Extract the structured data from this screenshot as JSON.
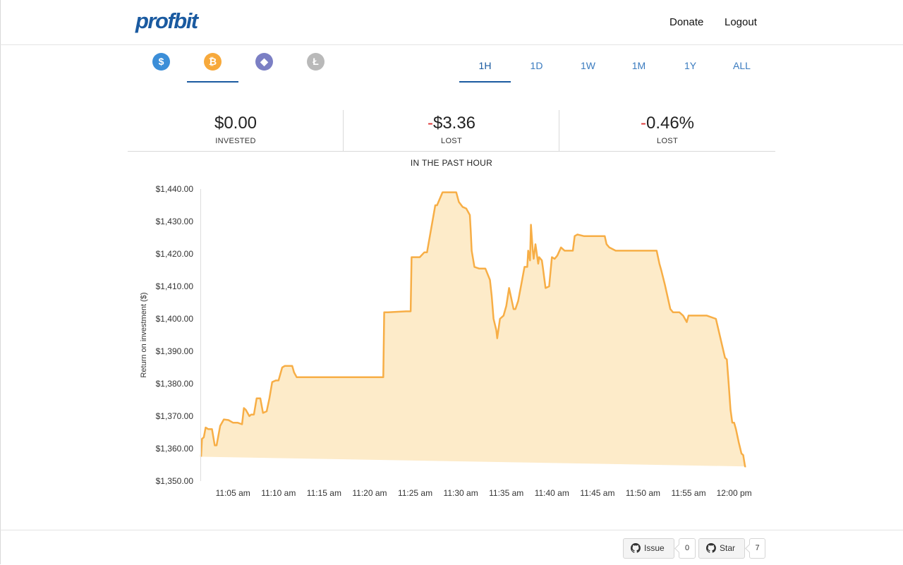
{
  "header": {
    "logo": "profbit",
    "nav": {
      "donate": "Donate",
      "logout": "Logout"
    }
  },
  "coins": [
    {
      "name": "USD",
      "glyph": "$",
      "color": "#3b8ed8",
      "active": false,
      "icon": "dollar-icon"
    },
    {
      "name": "Bitcoin",
      "glyph": "₿",
      "color": "#f7a93b",
      "active": true,
      "icon": "bitcoin-icon"
    },
    {
      "name": "Ethereum",
      "glyph": "◆",
      "color": "#7b7fc4",
      "active": false,
      "icon": "ethereum-icon"
    },
    {
      "name": "Litecoin",
      "glyph": "Ł",
      "color": "#b9b9b9",
      "active": false,
      "icon": "litecoin-icon"
    }
  ],
  "ranges": [
    {
      "label": "1H",
      "active": true
    },
    {
      "label": "1D",
      "active": false
    },
    {
      "label": "1W",
      "active": false
    },
    {
      "label": "1M",
      "active": false
    },
    {
      "label": "1Y",
      "active": false
    },
    {
      "label": "ALL",
      "active": false
    }
  ],
  "stats": {
    "invested": {
      "value": "$0.00",
      "label": "INVESTED"
    },
    "lost_amount": {
      "sign": "-",
      "value": "$3.36",
      "label": "LOST"
    },
    "lost_percent": {
      "sign": "-",
      "value": "0.46%",
      "label": "LOST"
    }
  },
  "chart_title": "IN THE PAST HOUR",
  "chart_data": {
    "type": "area",
    "ylabel": "Return on investment ($)",
    "ylim": [
      1350,
      1440
    ],
    "xlim": [
      1.5,
      61.5
    ],
    "y_ticks": [
      1350,
      1360,
      1370,
      1380,
      1390,
      1400,
      1410,
      1420,
      1430,
      1440
    ],
    "y_tick_labels": [
      "$1,350.00",
      "$1,360.00",
      "$1,370.00",
      "$1,380.00",
      "$1,390.00",
      "$1,400.00",
      "$1,410.00",
      "$1,420.00",
      "$1,430.00",
      "$1,440.00"
    ],
    "x_ticks": [
      5,
      10,
      15,
      20,
      25,
      30,
      35,
      40,
      45,
      50,
      55,
      60
    ],
    "x_tick_labels": [
      "11:05 am",
      "11:10 am",
      "11:15 am",
      "11:20 am",
      "11:25 am",
      "11:30 am",
      "11:35 am",
      "11:40 am",
      "11:45 am",
      "11:50 am",
      "11:55 am",
      "12:00 pm"
    ],
    "line_color": "#f7ae46",
    "fill_color": "#fdebc9",
    "grid": false,
    "x": [
      1.5,
      1.6,
      1.8,
      2.0,
      2.3,
      2.7,
      3.0,
      3.2,
      3.6,
      4.0,
      4.5,
      5.0,
      5.5,
      6.0,
      6.2,
      6.4,
      6.8,
      7.0,
      7.3,
      7.6,
      8.0,
      8.3,
      8.7,
      9.0,
      9.3,
      9.7,
      10.0,
      10.4,
      10.7,
      11.0,
      11.5,
      11.7,
      12.0,
      14.0,
      16.0,
      18.0,
      20.0,
      21.5,
      21.6,
      22.0,
      24.0,
      24.5,
      24.6,
      25.5,
      26.0,
      26.3,
      27.2,
      27.4,
      28.0,
      29.0,
      29.5,
      29.8,
      30.2,
      30.6,
      31.0,
      31.1,
      31.2,
      31.5,
      32.0,
      32.7,
      33.2,
      33.4,
      33.6,
      33.9,
      34.0,
      34.3,
      34.7,
      35.0,
      35.3,
      35.8,
      36.0,
      36.3,
      36.6,
      37.0,
      37.3,
      37.4,
      37.6,
      37.7,
      37.8,
      37.9,
      38.0,
      38.2,
      38.5,
      38.6,
      38.9,
      39.0,
      39.3,
      39.7,
      40.0,
      40.3,
      40.6,
      41.0,
      41.4,
      41.8,
      42.3,
      42.5,
      42.8,
      43.5,
      44.5,
      45.0,
      45.5,
      45.8,
      46.0,
      46.3,
      47.0,
      48.0,
      50.0,
      51.5,
      51.8,
      52.0,
      52.4,
      53.0,
      53.3,
      54.0,
      54.4,
      54.8,
      55.0,
      55.4,
      56.0,
      57.0,
      58.0,
      59.0,
      59.2,
      59.4,
      59.6,
      59.8,
      60.0,
      60.2,
      60.5,
      60.8,
      61.0,
      61.2,
      61.3,
      61.4,
      61.5
    ],
    "y": [
      1357.5,
      1363.0,
      1363.5,
      1366.5,
      1366.0,
      1366.0,
      1361.0,
      1361.0,
      1367.0,
      1369.0,
      1368.8,
      1368.0,
      1368.0,
      1367.5,
      1372.5,
      1372.0,
      1370.0,
      1370.5,
      1370.5,
      1375.5,
      1375.5,
      1371.0,
      1371.5,
      1375.5,
      1380.5,
      1381.0,
      1381.0,
      1385.0,
      1385.5,
      1385.5,
      1385.5,
      1383.5,
      1382.0,
      1382.0,
      1382.0,
      1382.0,
      1382.0,
      1382.0,
      1402.0,
      1402.0,
      1402.3,
      1402.3,
      1419.0,
      1419.0,
      1420.5,
      1420.5,
      1435.0,
      1435.0,
      1439.0,
      1439.0,
      1439.0,
      1436.0,
      1434.5,
      1434.0,
      1432.0,
      1427.0,
      1421.0,
      1416.0,
      1415.5,
      1415.5,
      1412.0,
      1407.0,
      1400.0,
      1396.5,
      1394.0,
      1400.0,
      1401.0,
      1404.0,
      1409.5,
      1403.0,
      1403.0,
      1405.5,
      1410.0,
      1416.0,
      1416.0,
      1421.0,
      1418.0,
      1429.0,
      1425.0,
      1421.0,
      1418.5,
      1423.0,
      1417.0,
      1419.0,
      1418.0,
      1416.0,
      1409.5,
      1410.0,
      1419.0,
      1418.5,
      1419.5,
      1422.0,
      1421.0,
      1421.0,
      1421.0,
      1425.5,
      1426.0,
      1425.5,
      1425.5,
      1425.5,
      1425.5,
      1425.5,
      1423.0,
      1422.0,
      1421.0,
      1421.0,
      1421.0,
      1421.0,
      1417.0,
      1415.0,
      1410.5,
      1403.0,
      1402.0,
      1402.0,
      1401.0,
      1399.0,
      1401.0,
      1401.0,
      1401.0,
      1401.0,
      1400.0,
      1388.0,
      1387.5,
      1380.0,
      1372.0,
      1368.0,
      1368.0,
      1366.0,
      1362.0,
      1358.5,
      1358.0,
      1354.5,
      1354.5
    ]
  },
  "footer": {
    "issue": {
      "label": "Issue",
      "count": "0"
    },
    "star": {
      "label": "Star",
      "count": "7"
    }
  }
}
